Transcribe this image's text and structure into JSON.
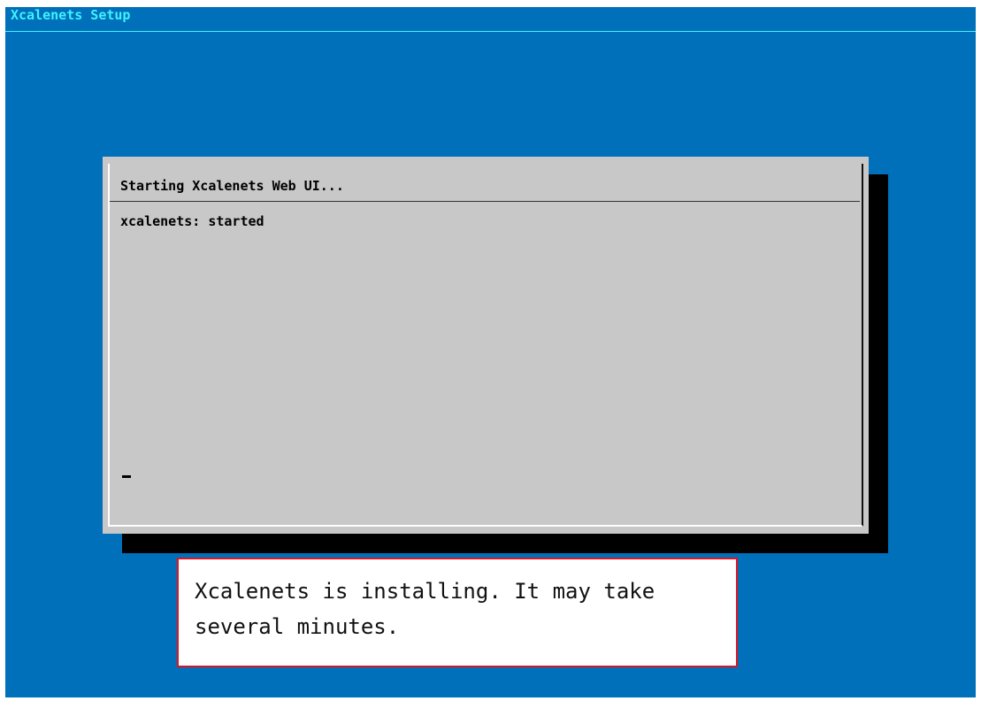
{
  "window": {
    "title": "Xcalenets Setup"
  },
  "dialog": {
    "title": "Starting Xcalenets Web UI...",
    "log_line": "xcalenets: started",
    "cursor": "_"
  },
  "callout": {
    "text": "Xcalenets is installing. It may take several minutes."
  },
  "colors": {
    "background": "#0070bb",
    "title_text": "#3ef3ff",
    "dialog_bg": "#c8c8c8",
    "callout_border": "#e0141e"
  }
}
